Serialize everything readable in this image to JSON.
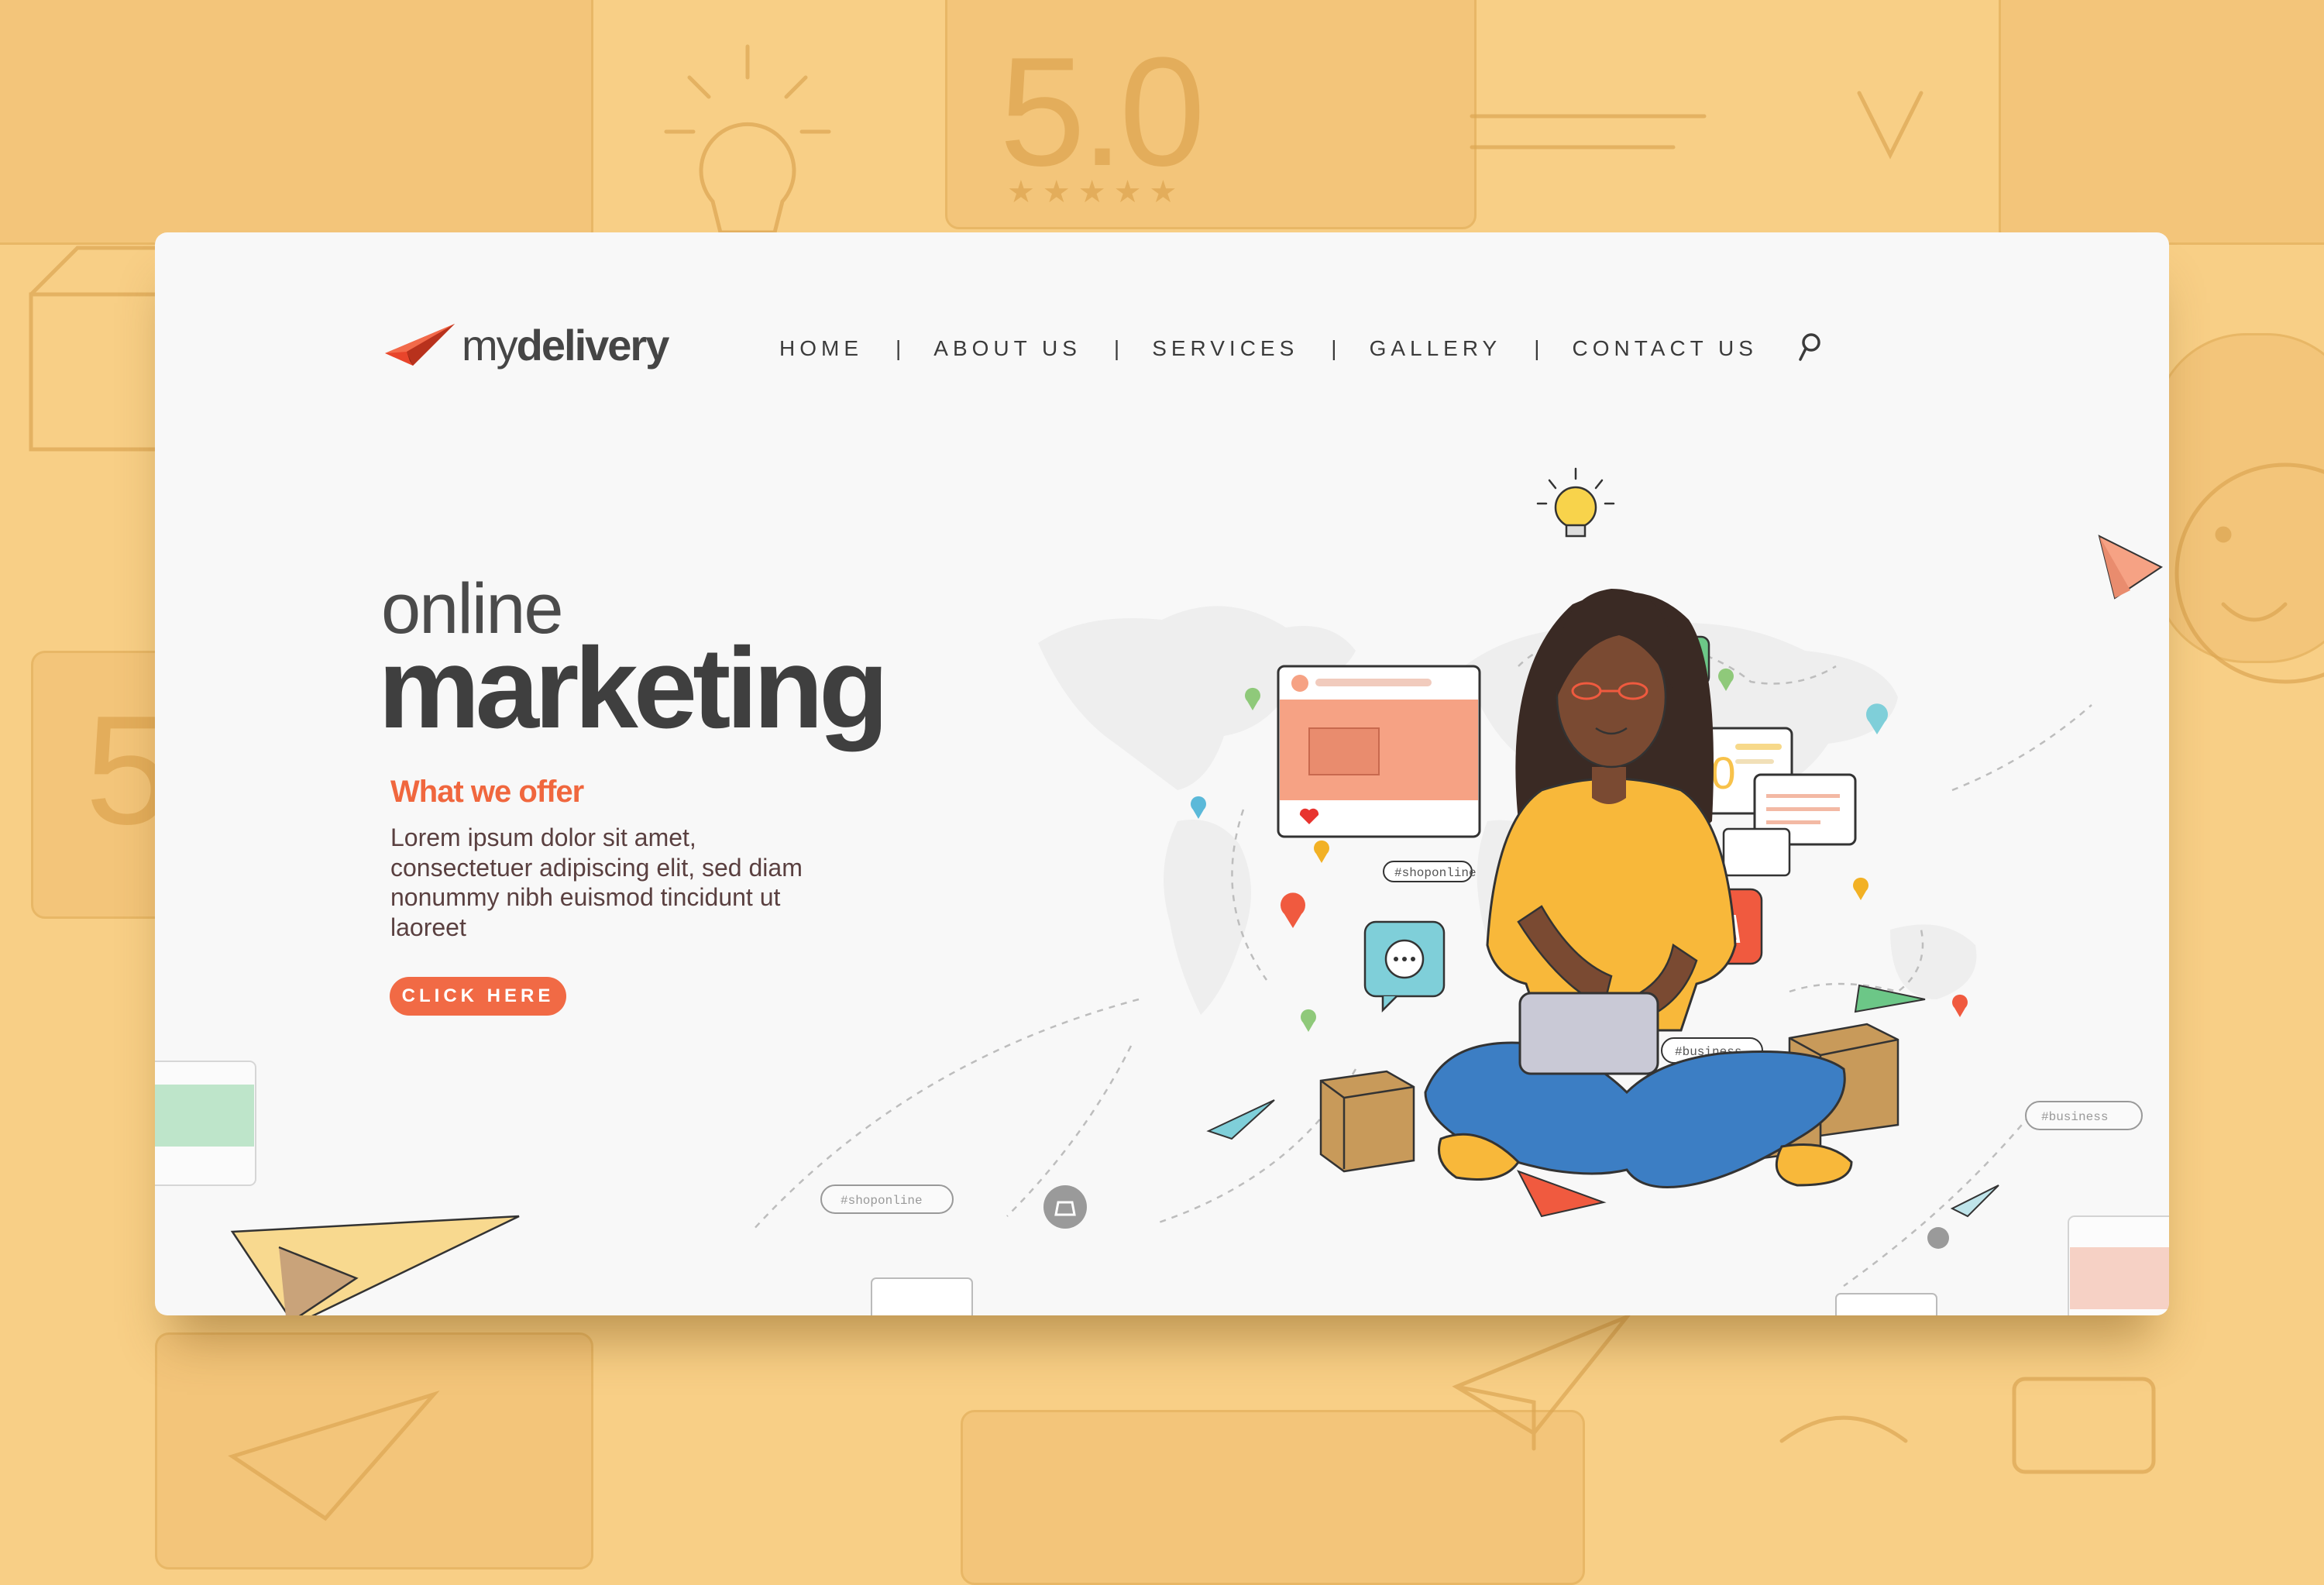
{
  "brand": {
    "name_part1": "my",
    "name_part2": "delivery",
    "accent": "#f0673e"
  },
  "nav": {
    "items": [
      "HOME",
      "ABOUT US",
      "SERVICES",
      "GALLERY",
      "CONTACT US"
    ],
    "separator": "|",
    "search_icon": "search-icon"
  },
  "hero": {
    "line1": "online",
    "line2": "marketing",
    "offer_title": "What we offer",
    "offer_text": "Lorem ipsum dolor sit amet, consectetuer adipiscing elit, sed diam nonummy nibh euismod tincidunt ut laoreet",
    "cta_label": "CLICK HERE"
  },
  "illustration": {
    "tags": [
      "#shoponline",
      "#business",
      "#business",
      "#shoponline"
    ],
    "rating": "5.0",
    "money_symbol": "$"
  },
  "background": {
    "rating": "5.0",
    "rating_small": "5"
  },
  "colors": {
    "background": "#f8cf86",
    "card": "#f8f8f8",
    "cta": "#f16a45",
    "shirt": "#f8b83a",
    "jeans": "#3c7ec4"
  }
}
